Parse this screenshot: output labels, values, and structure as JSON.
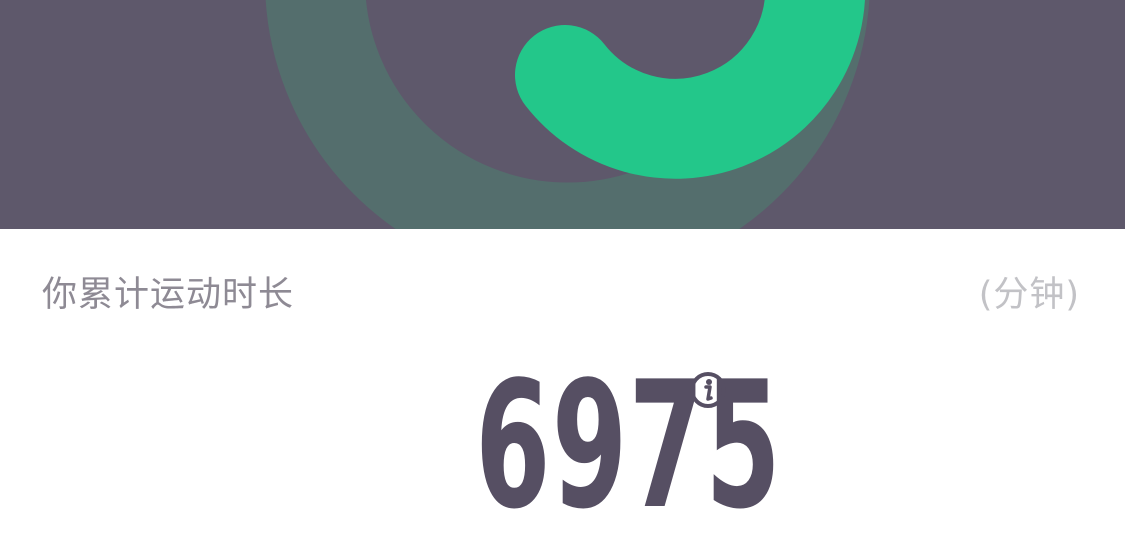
{
  "colors": {
    "hero_background": "#5e586b",
    "ring_track": "#546e6d",
    "ring_progress": "#23c78a",
    "number_color": "#564f63",
    "label_color": "#8e8a94",
    "unit_color": "#c2c2c6"
  },
  "hero": {
    "ring": {
      "icon": "progress-ring"
    }
  },
  "stats": {
    "label": "你累计运动时长",
    "unit": "(分钟)",
    "value": "6975",
    "info_icon": "info-icon"
  }
}
